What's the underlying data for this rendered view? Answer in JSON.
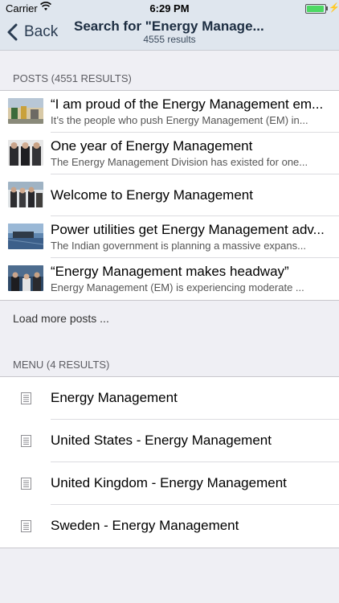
{
  "status_bar": {
    "carrier": "Carrier",
    "time": "6:29 PM"
  },
  "nav": {
    "back_label": "Back",
    "title": "Search for \"Energy Manage...",
    "subtitle": "4555 results"
  },
  "posts": {
    "header": "POSTS (4551 RESULTS)",
    "items": [
      {
        "title": "“I am proud of the Energy Management em...",
        "excerpt": "It’s the people who push Energy Management (EM) in..."
      },
      {
        "title": "One year of Energy Management",
        "excerpt": "The Energy Management Division has existed for one..."
      },
      {
        "title": "Welcome to Energy Management",
        "excerpt": ""
      },
      {
        "title": "Power utilities get Energy Management adv...",
        "excerpt": "The Indian government is planning a massive expans..."
      },
      {
        "title": "“Energy Management makes headway”",
        "excerpt": "Energy Management (EM) is experiencing moderate ..."
      }
    ],
    "load_more": "Load more posts ..."
  },
  "menu": {
    "header": "MENU (4 RESULTS)",
    "items": [
      {
        "label": "Energy Management"
      },
      {
        "label": "United States - Energy Management"
      },
      {
        "label": "United Kingdom - Energy Management"
      },
      {
        "label": "Sweden - Energy Management"
      }
    ]
  }
}
